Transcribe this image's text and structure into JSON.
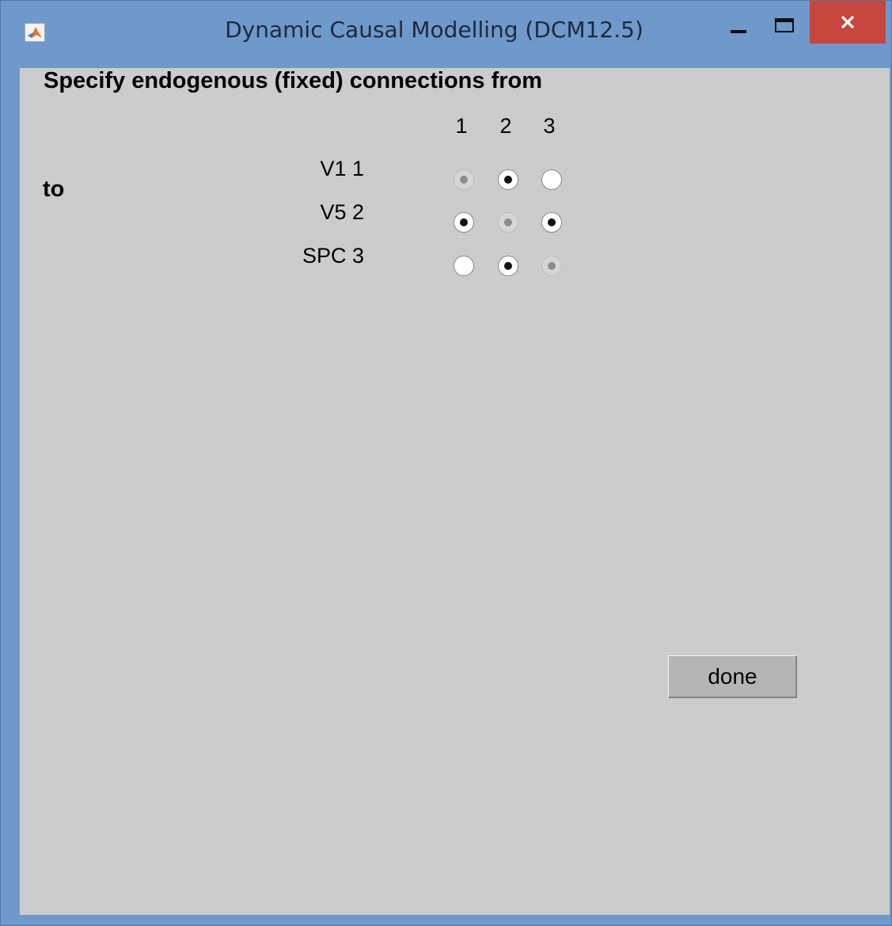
{
  "window": {
    "title": "Dynamic Causal Modelling (DCM12.5)",
    "icon": "matlab-icon",
    "controls": {
      "minimize": "minimize-icon",
      "maximize": "maximize-icon",
      "close": "close-icon",
      "close_color": "#c7463e"
    }
  },
  "form": {
    "prompt": "Specify endogenous (fixed) connections from",
    "to_label": "to",
    "columns": [
      "1",
      "2",
      "3"
    ],
    "rows": [
      {
        "label": "V1 1",
        "states": [
          "disabled",
          "checked",
          "unchecked"
        ]
      },
      {
        "label": "V5 2",
        "states": [
          "checked",
          "disabled",
          "checked"
        ]
      },
      {
        "label": "SPC 3",
        "states": [
          "unchecked",
          "checked",
          "disabled"
        ]
      }
    ],
    "done_label": "done"
  }
}
